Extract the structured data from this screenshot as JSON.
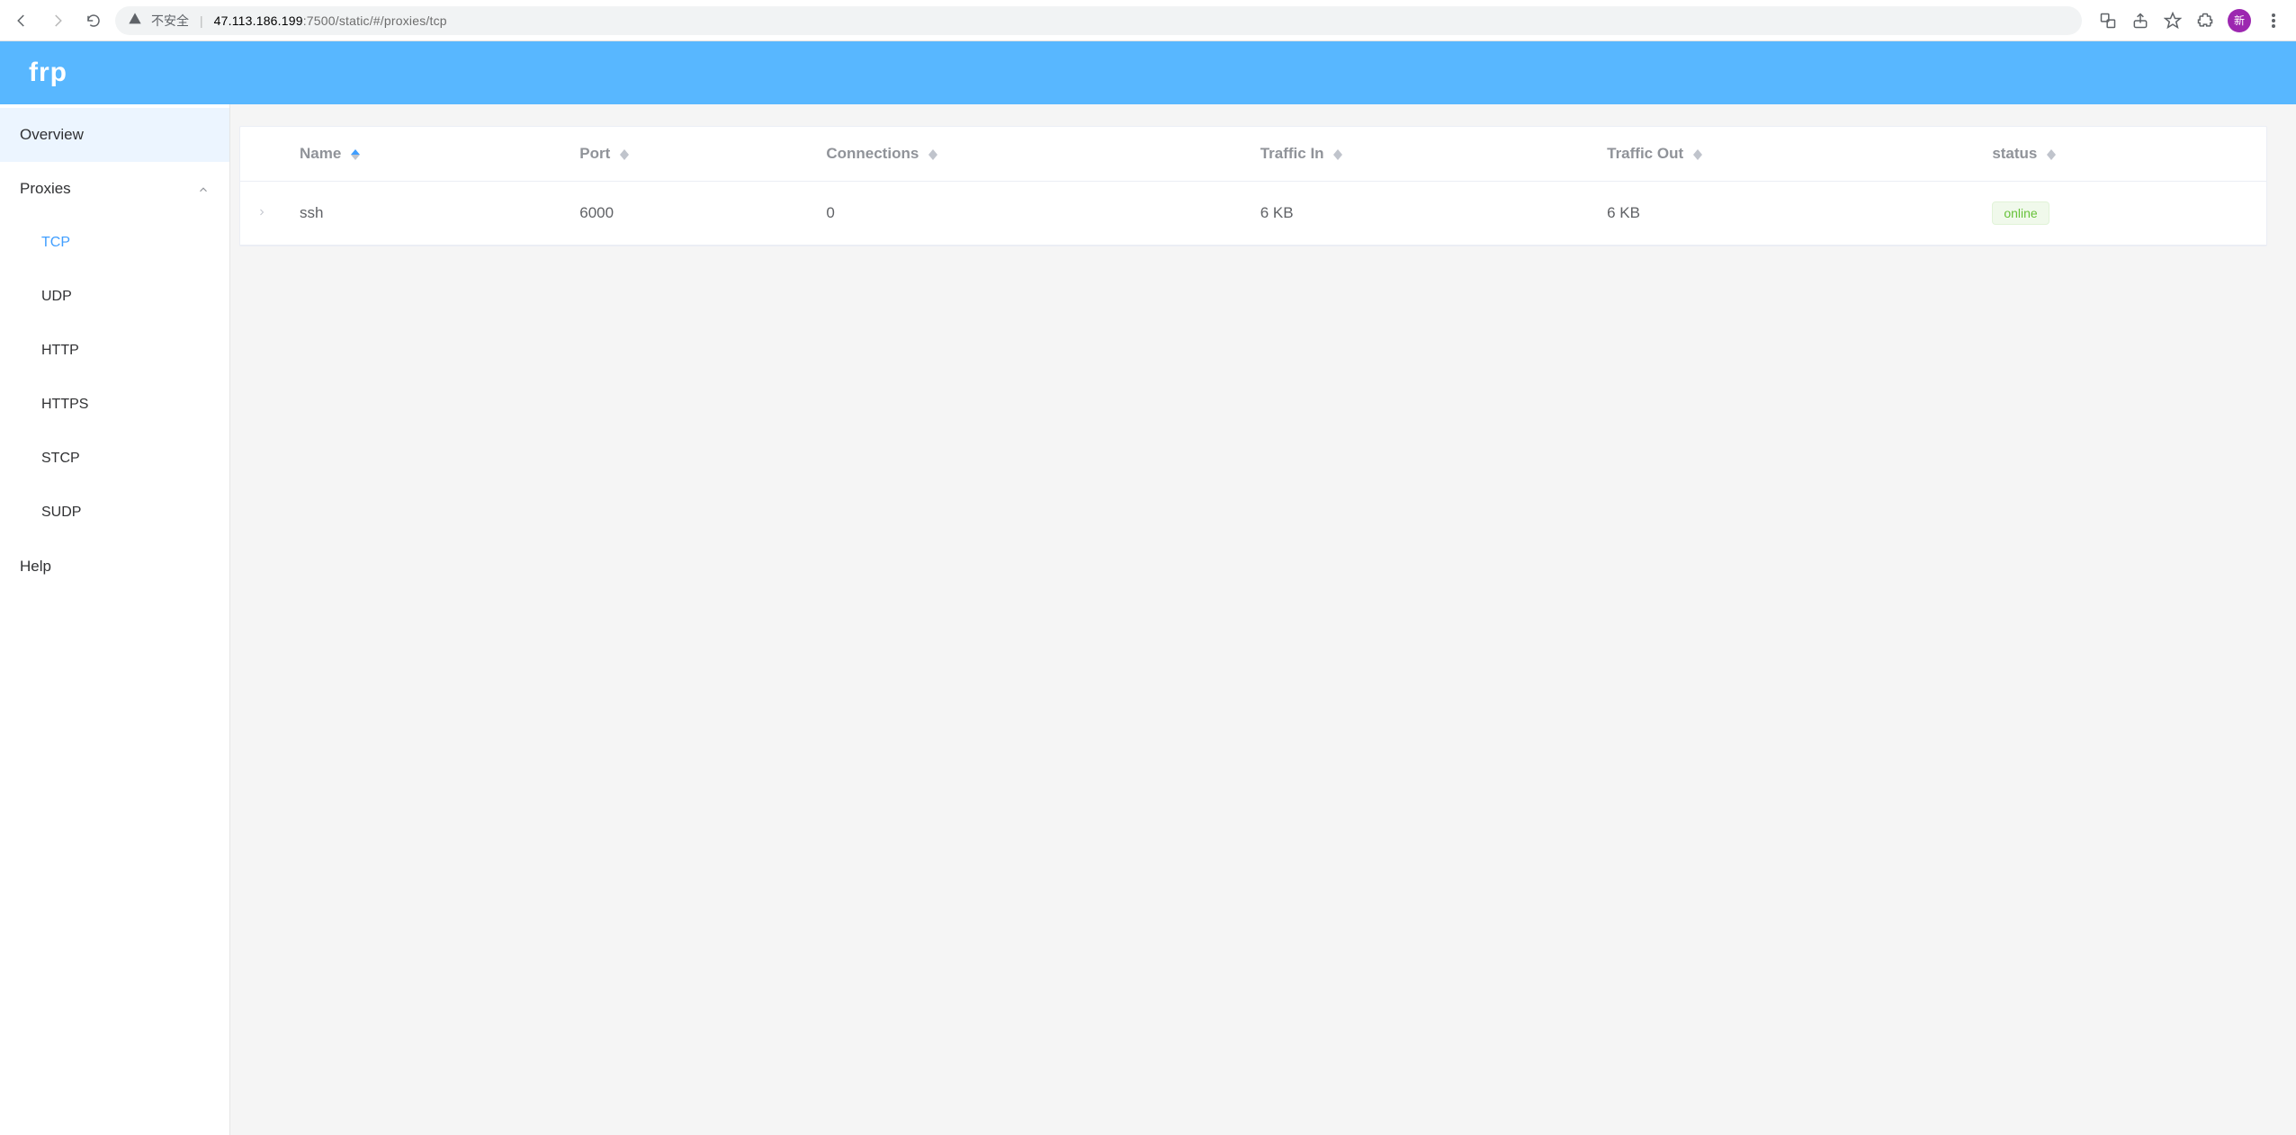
{
  "browser": {
    "insecure_label": "不安全",
    "url_host": "47.113.186.199",
    "url_rest": ":7500/static/#/proxies/tcp",
    "avatar_label": "新"
  },
  "header": {
    "title": "frp"
  },
  "sidebar": {
    "overview": "Overview",
    "proxies": "Proxies",
    "children": [
      "TCP",
      "UDP",
      "HTTP",
      "HTTPS",
      "STCP",
      "SUDP"
    ],
    "help": "Help"
  },
  "table": {
    "columns": [
      "Name",
      "Port",
      "Connections",
      "Traffic In",
      "Traffic Out",
      "status"
    ],
    "rows": [
      {
        "name": "ssh",
        "port": "6000",
        "connections": "0",
        "traffic_in": "6 KB",
        "traffic_out": "6 KB",
        "status": "online"
      }
    ]
  }
}
